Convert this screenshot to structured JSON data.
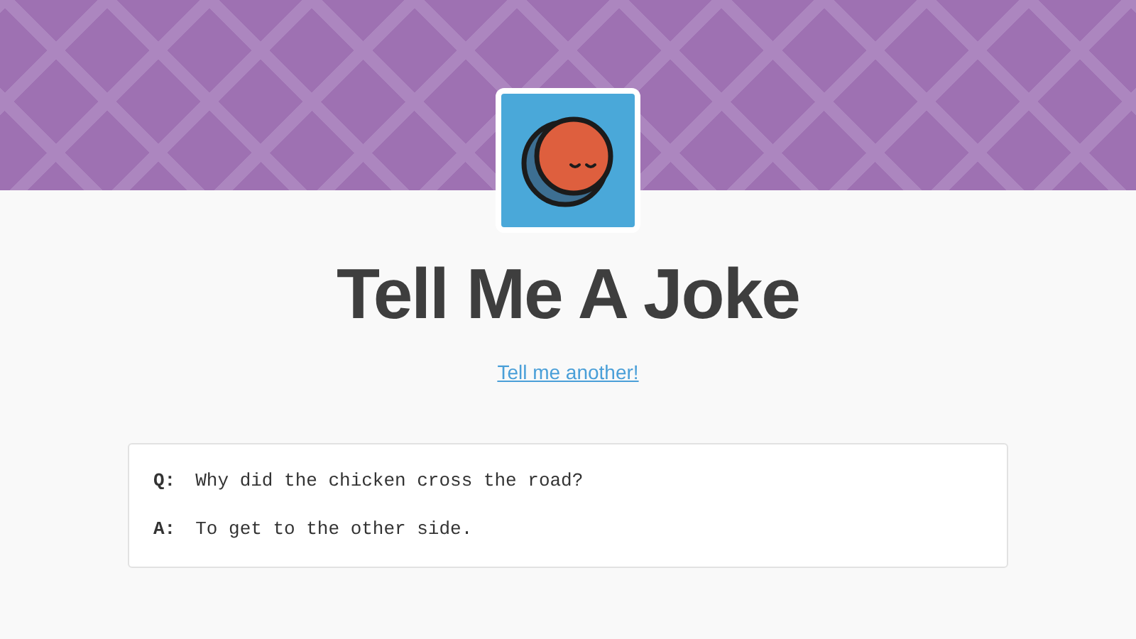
{
  "title": "Tell Me A Joke",
  "link": "Tell me another!",
  "joke": [
    {
      "label": "Q:",
      "text": "Why did the chicken cross the road?"
    },
    {
      "label": "A:",
      "text": "To get to the other side."
    }
  ]
}
